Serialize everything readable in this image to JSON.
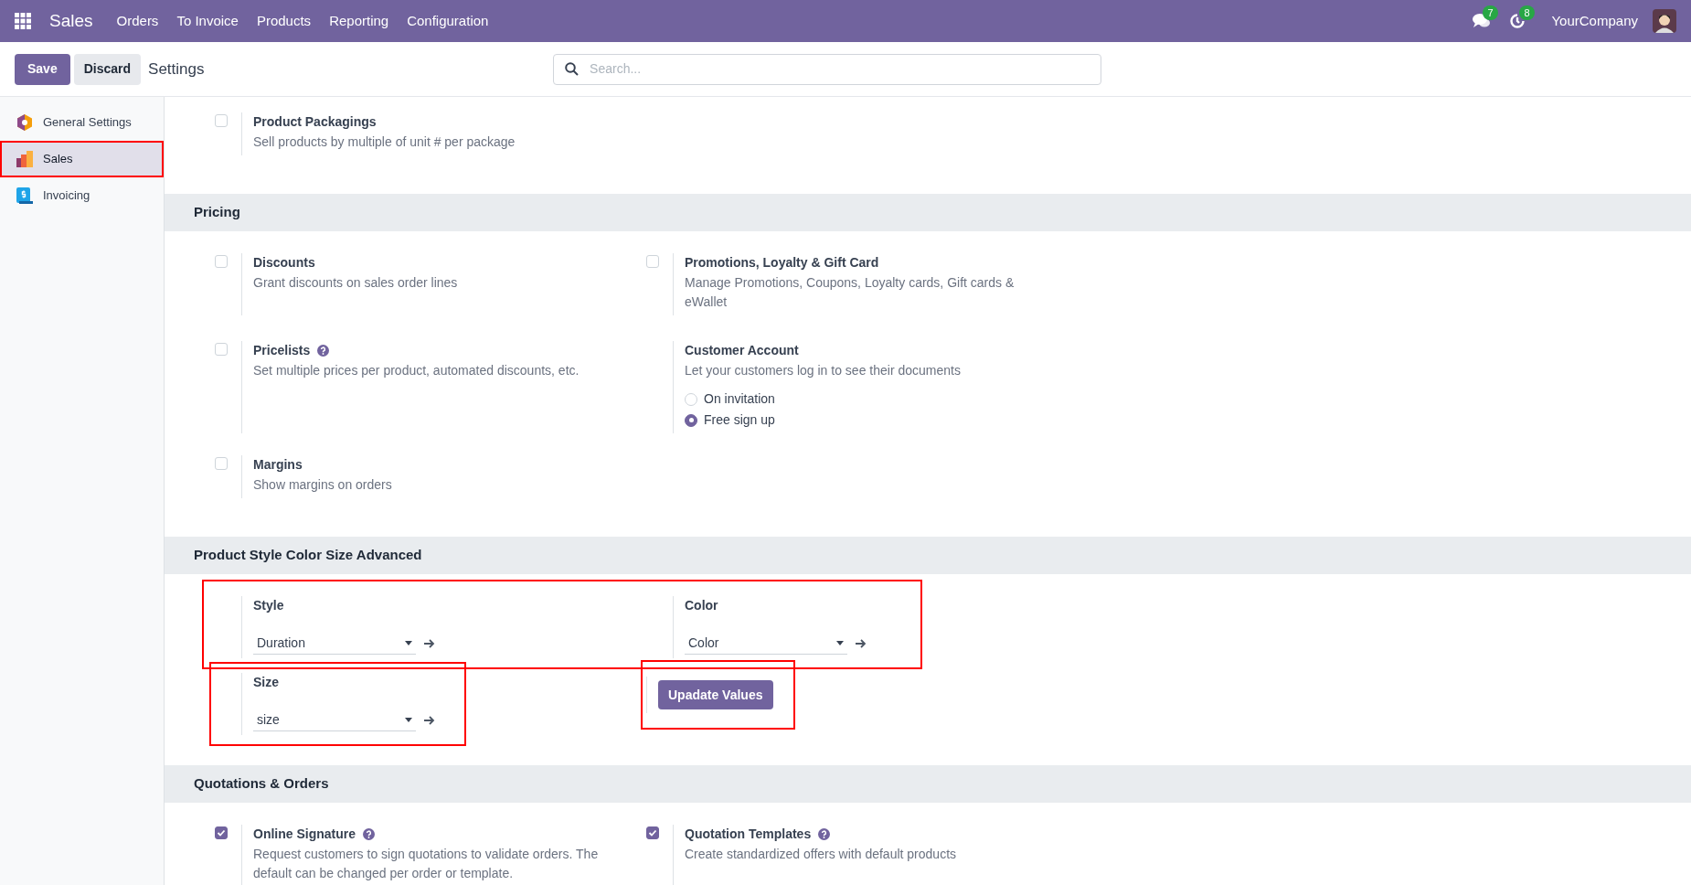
{
  "top_bar": {
    "app": "Sales",
    "menu": [
      "Orders",
      "To Invoice",
      "Products",
      "Reporting",
      "Configuration"
    ],
    "messages_count": "7",
    "activities_count": "8",
    "company": "YourCompany"
  },
  "control_panel": {
    "save": "Save",
    "discard": "Discard",
    "breadcrumb": "Settings",
    "search": {
      "placeholder": "Search..."
    }
  },
  "sidebar": {
    "items": [
      {
        "label": "General Settings",
        "selected": false
      },
      {
        "label": "Sales",
        "selected": true,
        "highlighted": true
      },
      {
        "label": "Invoicing",
        "selected": false
      }
    ]
  },
  "sections": [
    {
      "rows": [
        {
          "settings": [
            {
              "kind": "checkbox",
              "title": "Product Packagings",
              "description": "Sell products by multiple of unit # per package",
              "checked": false
            }
          ]
        }
      ]
    },
    {
      "title": "Pricing",
      "rows": [
        {
          "settings": [
            {
              "kind": "checkbox",
              "title": "Discounts",
              "description": "Grant discounts on sales order lines",
              "checked": false
            },
            {
              "kind": "checkbox",
              "title": "Promotions, Loyalty & Gift Card",
              "description": "Manage Promotions, Coupons, Loyalty cards, Gift cards & eWallet",
              "checked": false
            }
          ]
        },
        {
          "settings": [
            {
              "kind": "checkbox",
              "title": "Pricelists",
              "description": "Set multiple prices per product, automated discounts, etc.",
              "checked": false,
              "help": true
            },
            {
              "kind": "radio",
              "title": "Customer Account",
              "description": "Let your customers log in to see their documents",
              "options": [
                {
                  "label": "On invitation",
                  "selected": false
                },
                {
                  "label": "Free sign up",
                  "selected": true
                }
              ]
            }
          ]
        },
        {
          "settings": [
            {
              "kind": "checkbox",
              "title": "Margins",
              "description": "Show margins on orders",
              "checked": false
            }
          ]
        }
      ]
    },
    {
      "title": "Product Style Color Size Advanced",
      "rows": [
        {
          "highlighted": true,
          "settings": [
            {
              "kind": "select",
              "title": "Style",
              "value": "Duration"
            },
            {
              "kind": "select",
              "title": "Color",
              "value": "Color"
            }
          ]
        },
        {
          "settings": [
            {
              "kind": "select",
              "title": "Size",
              "value": "size",
              "highlighted": true
            },
            {
              "kind": "button",
              "label": "Upadate Values",
              "highlighted": true
            }
          ]
        }
      ]
    },
    {
      "title": "Quotations & Orders",
      "rows": [
        {
          "settings": [
            {
              "kind": "checkbox",
              "title": "Online Signature",
              "description": "Request customers to sign quotations to validate orders. The default can be changed per order or template.",
              "checked": true,
              "help": true
            },
            {
              "kind": "checkbox",
              "title": "Quotation Templates",
              "description": "Create standardized offers with default products",
              "checked": true,
              "help": true
            }
          ]
        }
      ]
    }
  ]
}
